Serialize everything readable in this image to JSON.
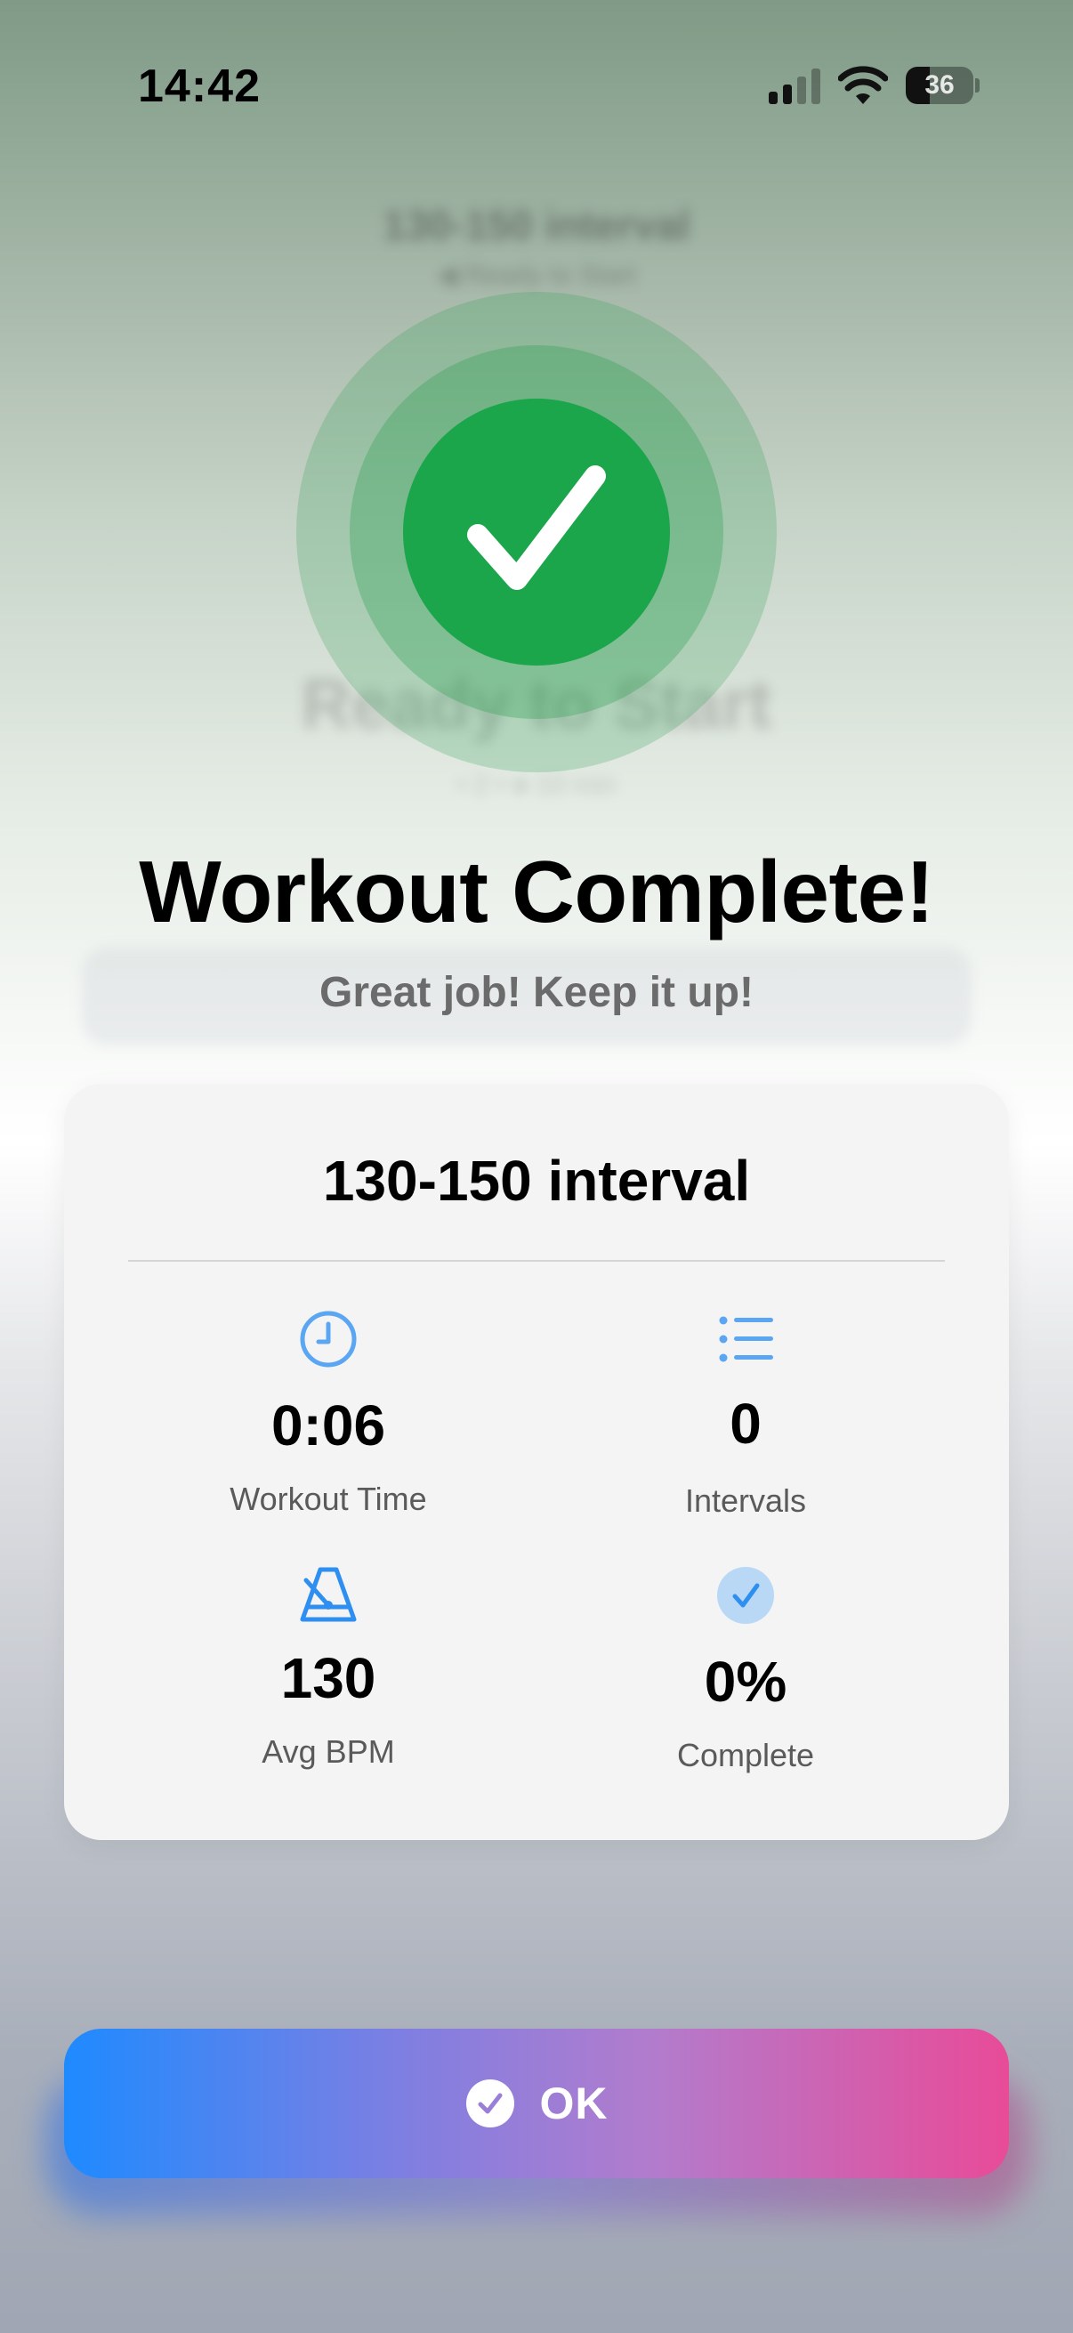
{
  "status_bar": {
    "time": "14:42",
    "battery_percent": "36",
    "battery_level": 0.36
  },
  "background": {
    "title": "130-150 interval",
    "subtitle": "◀ Ready to Start",
    "state_text": "Ready to Start",
    "meta": "• 2  •  ●  10 min"
  },
  "completion": {
    "headline": "Workout Complete!",
    "subline": "Great job! Keep it up!",
    "badge_color": "#1ba64b"
  },
  "summary": {
    "workout_name": "130-150 interval",
    "stats": [
      {
        "icon": "clock-icon",
        "value": "0:06",
        "label": "Workout Time"
      },
      {
        "icon": "list-icon",
        "value": "0",
        "label": "Intervals"
      },
      {
        "icon": "metronome-icon",
        "value": "130",
        "label": "Avg BPM"
      },
      {
        "icon": "checkmark-circle-icon",
        "value": "0%",
        "label": "Complete"
      }
    ]
  },
  "ok_button": {
    "label": "OK",
    "icon": "checkmark-circle-icon",
    "gradient_start": "#1e8aff",
    "gradient_end": "#e84b98"
  },
  "colors": {
    "accent_blue": "#2f8ff0",
    "success_green": "#1ba64b"
  }
}
